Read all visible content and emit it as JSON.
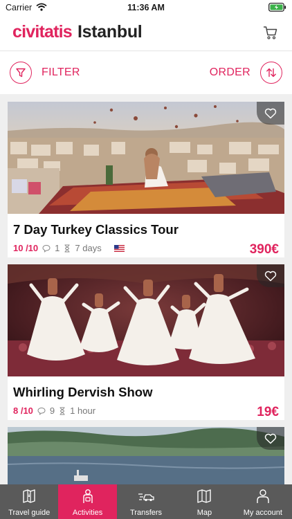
{
  "status_bar": {
    "carrier": "Carrier",
    "time": "11:36 AM"
  },
  "header": {
    "brand": "civitatis",
    "city": "Istanbul"
  },
  "controls": {
    "filter_label": "FILTER",
    "order_label": "ORDER"
  },
  "activities": [
    {
      "title": "7 Day Turkey Classics Tour",
      "rating": "10 /10",
      "reviews": "1",
      "duration": "7 days",
      "price": "390€"
    },
    {
      "title": "Whirling Dervish Show",
      "rating": "8 /10",
      "reviews": "9",
      "duration": "1 hour",
      "price": "19€"
    }
  ],
  "nav": [
    {
      "label": "Travel guide",
      "icon": "map-book-icon"
    },
    {
      "label": "Activities",
      "icon": "traveler-icon"
    },
    {
      "label": "Transfers",
      "icon": "transfer-car-icon"
    },
    {
      "label": "Map",
      "icon": "map-icon"
    },
    {
      "label": "My account",
      "icon": "user-icon"
    }
  ],
  "colors": {
    "accent": "#e0245e",
    "nav_bg": "#5a5a5a"
  }
}
